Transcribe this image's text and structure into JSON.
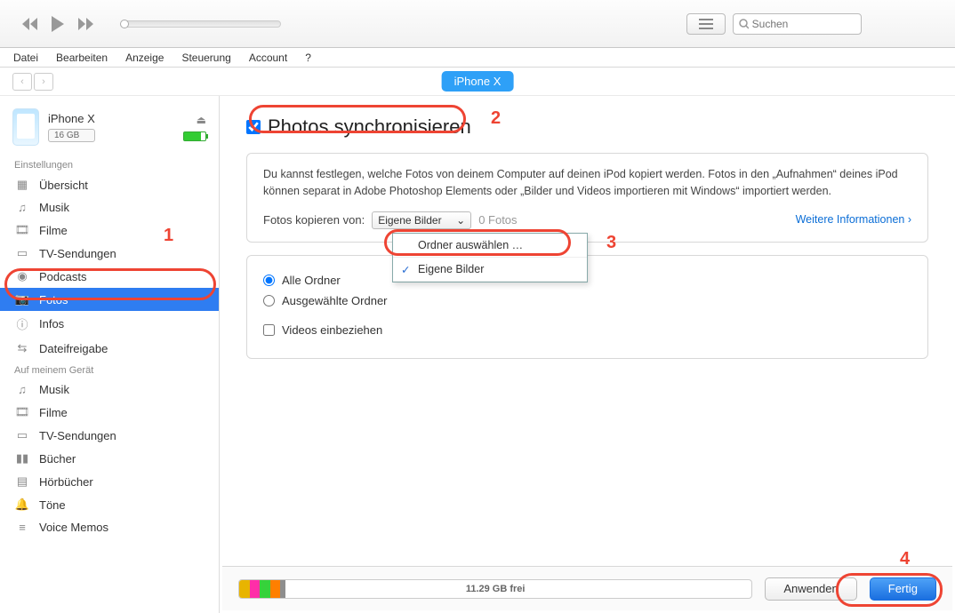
{
  "menubar": [
    "Datei",
    "Bearbeiten",
    "Anzeige",
    "Steuerung",
    "Account",
    "?"
  ],
  "search_placeholder": "Suchen",
  "device_pill": "iPhone X",
  "device": {
    "name": "iPhone X",
    "capacity": "16 GB"
  },
  "sections": {
    "settings_h": "Einstellungen",
    "device_h": "Auf meinem Gerät",
    "settings": [
      {
        "icon": "tile",
        "label": "Übersicht"
      },
      {
        "icon": "note",
        "label": "Musik"
      },
      {
        "icon": "film",
        "label": "Filme"
      },
      {
        "icon": "tv",
        "label": "TV-Sendungen"
      },
      {
        "icon": "pod",
        "label": "Podcasts"
      },
      {
        "icon": "cam",
        "label": "Fotos"
      },
      {
        "icon": "info",
        "label": "Infos"
      },
      {
        "icon": "share",
        "label": "Dateifreigabe"
      }
    ],
    "ondevice": [
      {
        "icon": "note",
        "label": "Musik"
      },
      {
        "icon": "film",
        "label": "Filme"
      },
      {
        "icon": "tv",
        "label": "TV-Sendungen"
      },
      {
        "icon": "book",
        "label": "Bücher"
      },
      {
        "icon": "audio",
        "label": "Hörbücher"
      },
      {
        "icon": "bell",
        "label": "Töne"
      },
      {
        "icon": "memo",
        "label": "Voice Memos"
      }
    ]
  },
  "main": {
    "sync_label": "Photos synchronisieren",
    "info_text": "Du kannst festlegen, welche Fotos von deinem Computer auf deinen iPod kopiert werden. Fotos in den „Aufnahmen“ deines iPod können separat in Adobe Photoshop Elements oder „Bilder und Videos importieren mit Windows“ importiert werden.",
    "copy_from_label": "Fotos kopieren von:",
    "select_value": "Eigene Bilder",
    "count_text": "0 Fotos",
    "more_info": "Weitere Informationen",
    "dropdown": {
      "choose": "Ordner auswählen …",
      "own": "Eigene Bilder"
    },
    "radio_all": "Alle Ordner",
    "radio_sel": "Ausgewählte Ordner",
    "check_vid": "Videos einbeziehen"
  },
  "bottom": {
    "free": "11.29 GB frei",
    "apply": "Anwenden",
    "done": "Fertig"
  },
  "anno": {
    "n1": "1",
    "n2": "2",
    "n3": "3",
    "n4": "4"
  }
}
